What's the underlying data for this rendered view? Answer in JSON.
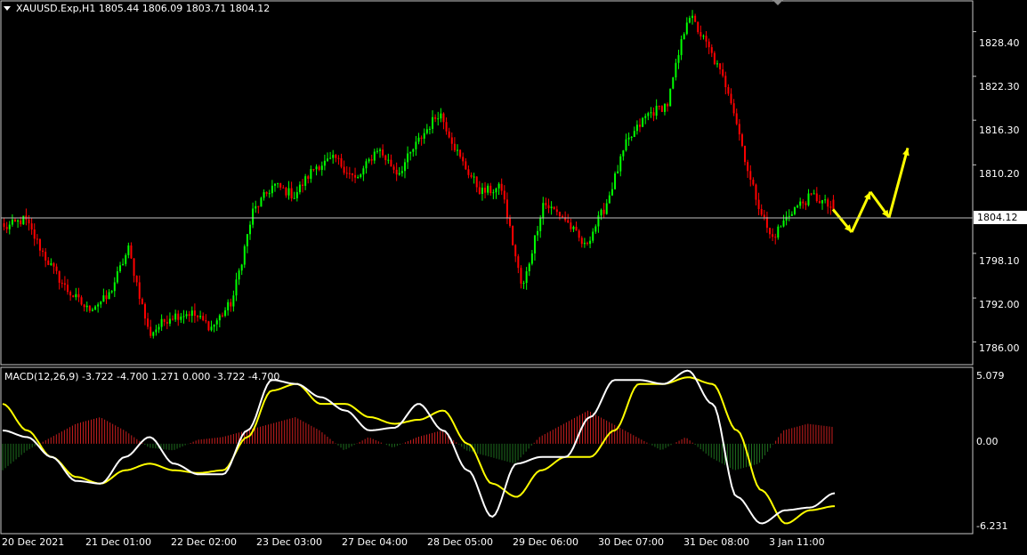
{
  "window": {
    "symbol_info": "XAUUSD.Exp,H1  1805.44 1806.09 1803.71 1804.12",
    "current_price_label": "1804.12"
  },
  "macd": {
    "label": "MACD(12,26,9) -3.722 -4.700 1.271 0.000 -3.722 -4.700",
    "axis_labels": [
      "5.079",
      "0.00",
      "-6.231"
    ]
  },
  "price_axis_labels": [
    "1828.40",
    "1822.30",
    "1816.30",
    "1810.20",
    "1798.10",
    "1792.00",
    "1786.00"
  ],
  "time_axis_labels": [
    "20 Dec 2021",
    "21 Dec 01:00",
    "22 Dec 02:00",
    "23 Dec 03:00",
    "27 Dec 04:00",
    "28 Dec 05:00",
    "29 Dec 06:00",
    "30 Dec 07:00",
    "31 Dec 08:00",
    "3 Jan 11:00"
  ],
  "colors": {
    "background": "#000000",
    "bull_candle": "#00ff00",
    "bear_candle": "#ff0000",
    "grid_line": "#c0c0c0",
    "macd_main": "#ffffff",
    "macd_signal": "#ffff00",
    "hist_positive": "#c81e1e",
    "hist_negative": "#1e6e1e",
    "arrow": "#ffff00"
  },
  "chart_data": [
    {
      "type": "candlestick",
      "title": "XAUUSD.Exp,H1",
      "ylim": [
        1783.5,
        1832.0
      ],
      "last_price": 1804.12,
      "ohlc_last": {
        "open": 1805.44,
        "high": 1806.09,
        "low": 1803.71,
        "close": 1804.12
      },
      "x": [
        "20 Dec 2021",
        "21 Dec 01:00",
        "22 Dec 02:00",
        "23 Dec 03:00",
        "27 Dec 04:00",
        "28 Dec 05:00",
        "29 Dec 06:00",
        "30 Dec 07:00",
        "31 Dec 08:00",
        "3 Jan 11:00"
      ],
      "close_path": [
        1801.5,
        1802.8,
        1797.5,
        1793.2,
        1790.5,
        1792.0,
        1798.7,
        1787.0,
        1789.5,
        1790.0,
        1788.0,
        1791.5,
        1803.8,
        1807.5,
        1806.0,
        1810.0,
        1811.0,
        1808.0,
        1812.5,
        1809.0,
        1813.5,
        1817.5,
        1811.0,
        1806.5,
        1807.0,
        1793.0,
        1805.0,
        1803.0,
        1799.0,
        1804.5,
        1813.0,
        1817.0,
        1818.5,
        1831.0,
        1826.0,
        1820.0,
        1808.0,
        1800.0,
        1804.0,
        1806.0,
        1804.12
      ],
      "projection_path": [
        1804.12,
        1801.0,
        1806.5,
        1803.0,
        1812.5
      ]
    },
    {
      "type": "line",
      "title": "MACD(12,26,9)",
      "ylim": [
        -6.231,
        5.079
      ],
      "values": {
        "main": -3.722,
        "signal": -4.7,
        "histogram": 1.271
      },
      "series": [
        {
          "name": "main",
          "values": [
            1.0,
            0.5,
            -1.0,
            -2.8,
            -3.0,
            -1.0,
            0.5,
            -1.5,
            -2.3,
            -2.3,
            1.0,
            4.8,
            4.5,
            3.5,
            2.5,
            1.0,
            1.2,
            3.0,
            1.0,
            -2.0,
            -5.5,
            -1.5,
            -1.0,
            -1.0,
            2.0,
            4.8,
            4.8,
            4.5,
            5.5,
            3.0,
            -4.0,
            -6.0,
            -5.0,
            -4.8,
            -3.722
          ]
        },
        {
          "name": "signal",
          "values": [
            3.0,
            1.0,
            -1.0,
            -2.5,
            -3.0,
            -2.0,
            -1.5,
            -2.0,
            -2.2,
            -2.0,
            0.5,
            4.0,
            4.5,
            3.0,
            3.0,
            2.0,
            1.5,
            1.8,
            2.5,
            0.0,
            -3.0,
            -4.0,
            -2.0,
            -1.0,
            -1.0,
            1.0,
            4.5,
            4.5,
            5.0,
            4.5,
            1.0,
            -3.5,
            -6.0,
            -5.0,
            -4.7
          ]
        }
      ],
      "histogram": [
        -2.0,
        -0.5,
        0.5,
        1.5,
        2.0,
        1.0,
        -0.3,
        -0.5,
        0.3,
        0.5,
        1.0,
        1.5,
        2.0,
        1.0,
        -0.5,
        0.5,
        -0.3,
        0.5,
        1.0,
        -0.5,
        -1.0,
        -1.5,
        0.5,
        1.5,
        2.5,
        1.5,
        0.5,
        -0.5,
        0.5,
        -1.0,
        -2.0,
        -1.5,
        1.0,
        1.5,
        1.271
      ]
    }
  ]
}
